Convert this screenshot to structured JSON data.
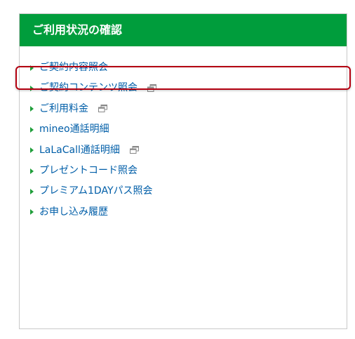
{
  "panel": {
    "title": "ご利用状況の確認",
    "items": [
      {
        "label": "ご契約内容照会",
        "external": false
      },
      {
        "label": "ご契約コンテンツ照会",
        "external": true
      },
      {
        "label": "ご利用料金",
        "external": true
      },
      {
        "label": "mineo通話明細",
        "external": false
      },
      {
        "label": "LaLaCall通話明細",
        "external": true
      },
      {
        "label": "プレゼントコード照会",
        "external": false
      },
      {
        "label": "プレミアム1DAYパス照会",
        "external": false
      },
      {
        "label": "お申し込み履歴",
        "external": false
      }
    ],
    "highlighted_index": 0
  },
  "colors": {
    "header_bg": "#009d3c",
    "link": "#005ea8",
    "arrow": "#1f9e3a",
    "highlight": "#b30010"
  },
  "icons": {
    "item_bullet": "triangle-right-icon",
    "external": "external-window-icon"
  }
}
